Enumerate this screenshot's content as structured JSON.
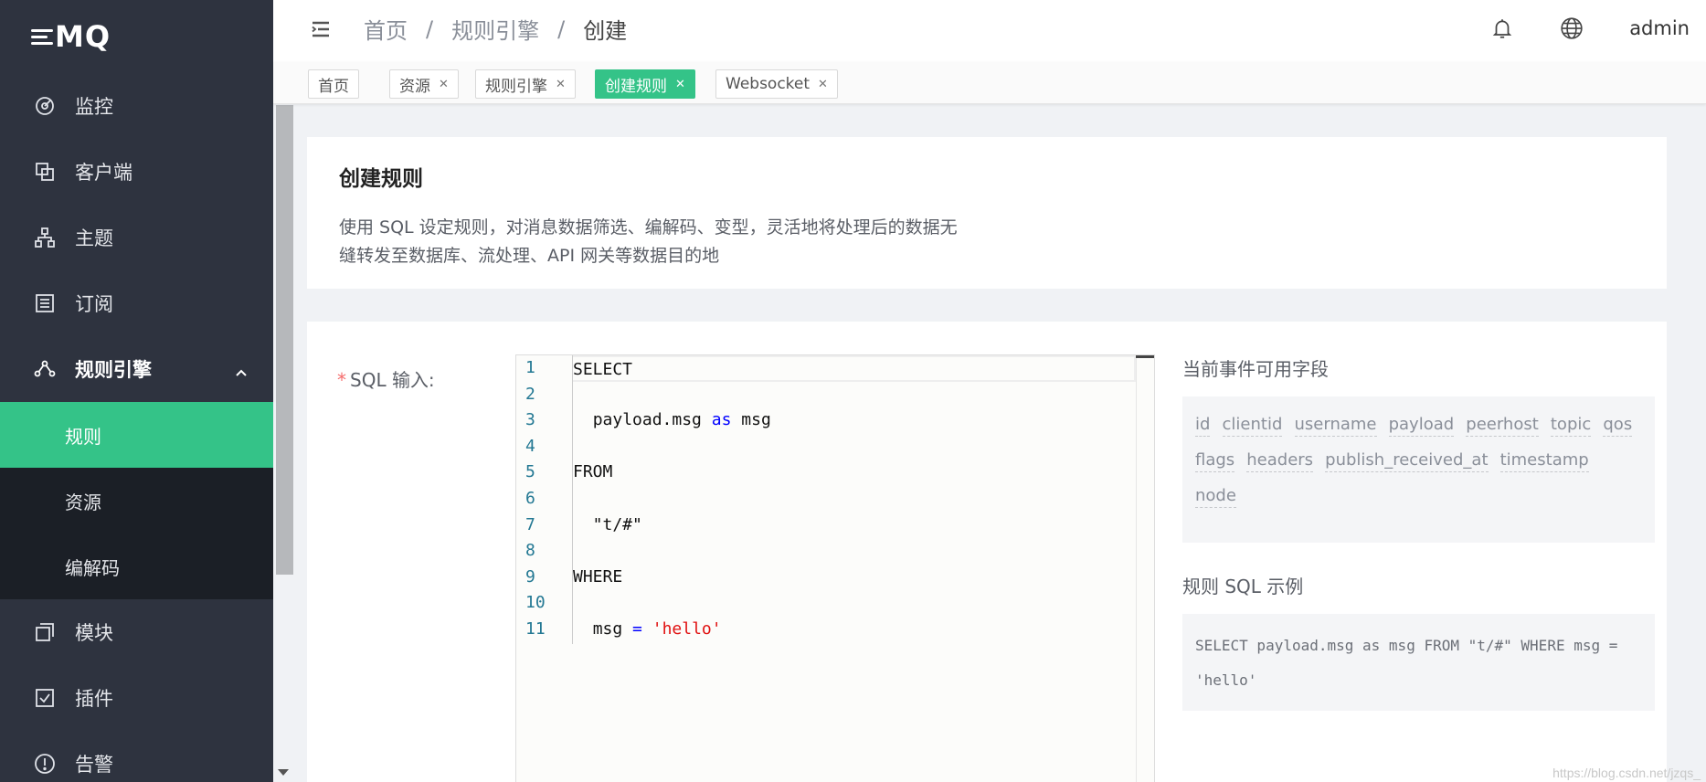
{
  "app": {
    "logo": "MQ"
  },
  "sidebar": {
    "items": [
      {
        "label": "监控",
        "icon": "monitor-icon"
      },
      {
        "label": "客户端",
        "icon": "clients-icon"
      },
      {
        "label": "主题",
        "icon": "topics-icon"
      },
      {
        "label": "订阅",
        "icon": "subscriptions-icon"
      },
      {
        "label": "规则引擎",
        "icon": "rule-engine-icon"
      },
      {
        "label": "模块",
        "icon": "modules-icon"
      },
      {
        "label": "插件",
        "icon": "plugins-icon"
      },
      {
        "label": "告警",
        "icon": "alarm-icon"
      }
    ],
    "submenu": [
      {
        "label": "规则",
        "active": true
      },
      {
        "label": "资源",
        "active": false
      },
      {
        "label": "编解码",
        "active": false
      }
    ]
  },
  "header": {
    "breadcrumb": [
      "首页",
      "规则引擎",
      "创建"
    ],
    "separator": "/",
    "user": "admin"
  },
  "tags": [
    {
      "label": "首页",
      "closable": false
    },
    {
      "label": "资源",
      "closable": true
    },
    {
      "label": "规则引擎",
      "closable": true
    },
    {
      "label": "创建规则",
      "closable": true,
      "active": true
    },
    {
      "label": "Websocket",
      "closable": true
    }
  ],
  "intro": {
    "title": "创建规则",
    "description_line1": "使用 SQL 设定规则，对消息数据筛选、编解码、变型，灵活地将处理后的数据无",
    "description_line2": "缝转发至数据库、流处理、API 网关等数据目的地"
  },
  "form": {
    "sql_required_mark": "*",
    "sql_label": "SQL 输入:",
    "sql_lines": [
      "SELECT",
      "",
      "  payload.msg as msg",
      "",
      "FROM",
      "",
      "  \"t/#\"",
      "",
      "WHERE",
      "",
      "  msg = 'hello'"
    ],
    "line_numbers": [
      "1",
      "2",
      "3",
      "4",
      "5",
      "6",
      "7",
      "8",
      "9",
      "10",
      "11"
    ]
  },
  "fields_panel": {
    "title": "当前事件可用字段",
    "fields": [
      "id",
      "clientid",
      "username",
      "payload",
      "peerhost",
      "topic",
      "qos",
      "flags",
      "headers",
      "publish_received_at",
      "timestamp",
      "node"
    ]
  },
  "sample_panel": {
    "title": "规则 SQL 示例",
    "sql": "SELECT payload.msg as msg FROM \"t/#\" WHERE msg = 'hello'"
  },
  "watermark": "https://blog.csdn.net/jzqs_",
  "colors": {
    "accent": "#34c388",
    "sidebar_bg": "#2e333f",
    "submenu_bg": "#1b1f26"
  }
}
